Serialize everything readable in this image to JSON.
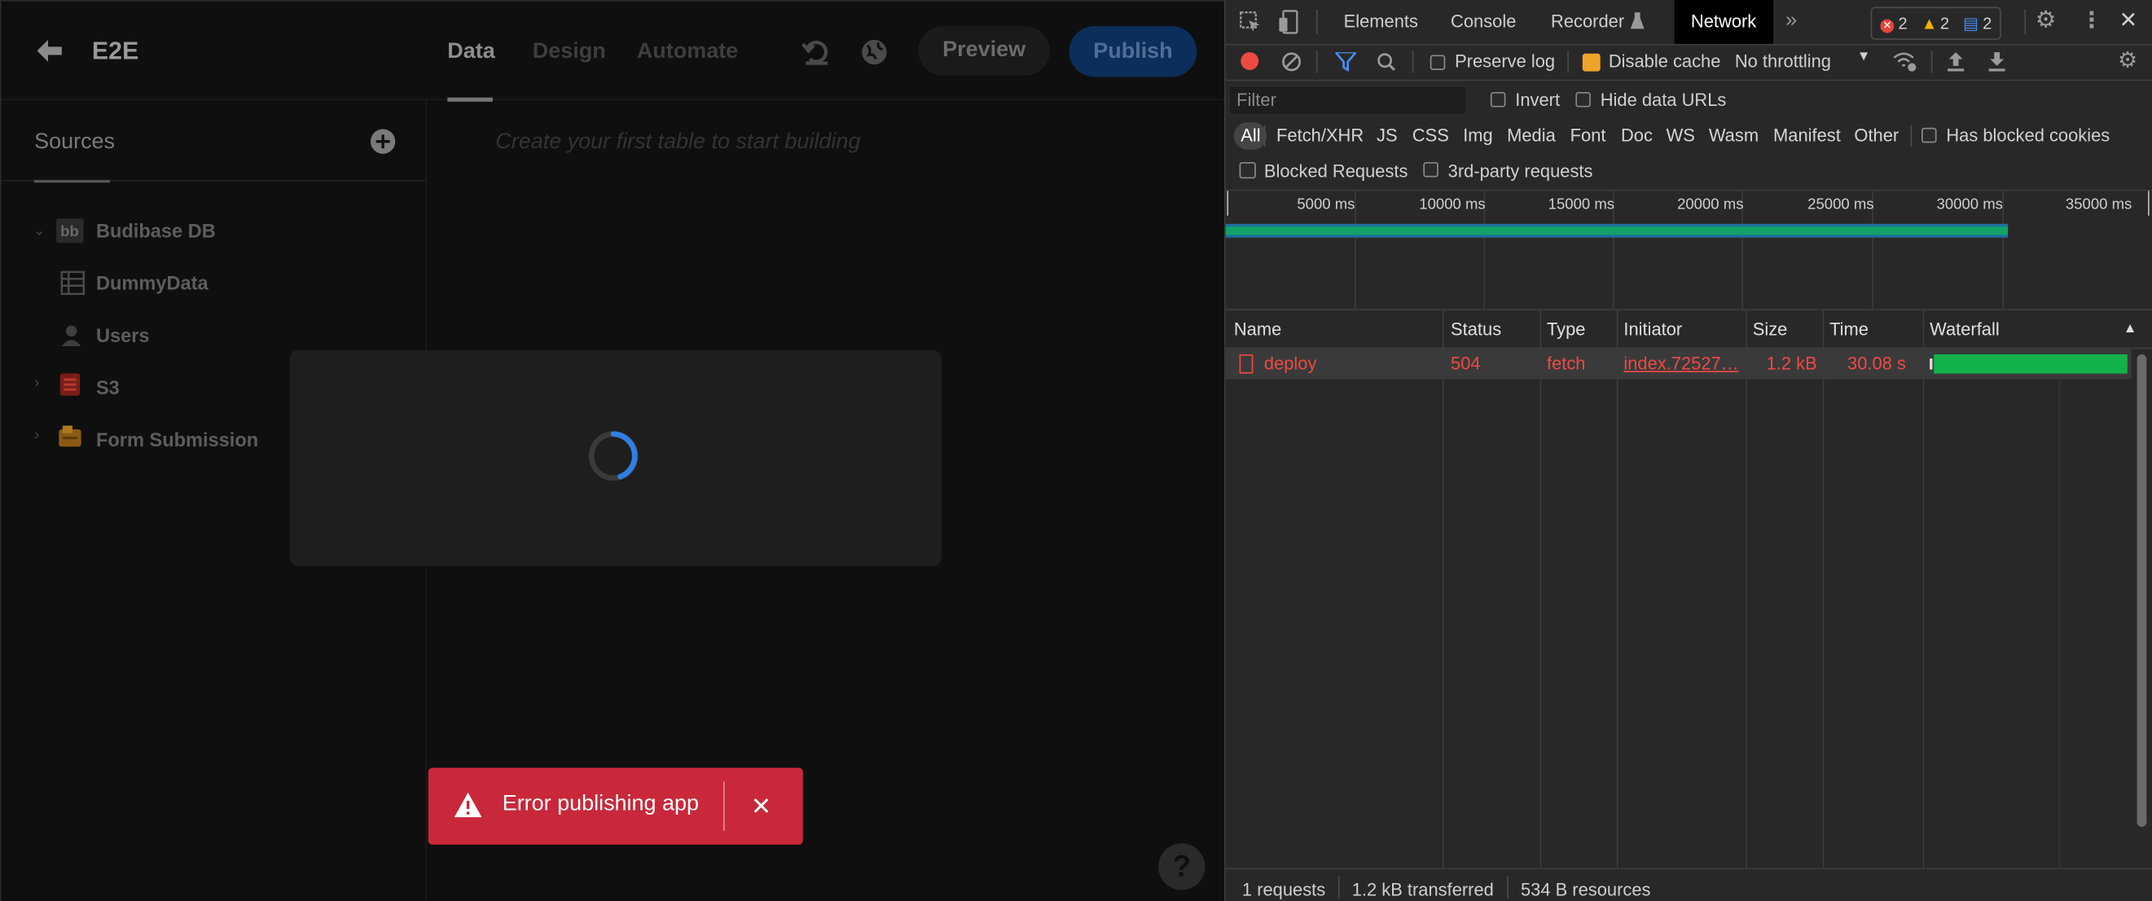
{
  "app": {
    "name": "E2E",
    "nav_tabs": [
      "Data",
      "Design",
      "Automate"
    ],
    "preview_label": "Preview",
    "publish_label": "Publish",
    "sidebar_title": "Sources",
    "sources": [
      {
        "label": "Budibase DB",
        "icon": "budibase-db-icon"
      },
      {
        "label": "DummyData",
        "icon": "table-icon"
      },
      {
        "label": "Users",
        "icon": "users-icon"
      },
      {
        "label": "S3",
        "icon": "s3-icon"
      },
      {
        "label": "Form Submission",
        "icon": "form-icon"
      }
    ],
    "empty_hint": "Create your first table to start building",
    "toast_text": "Error publishing app",
    "help_label": "?"
  },
  "devtools": {
    "tabs": [
      "Elements",
      "Console",
      "Recorder",
      "Network"
    ],
    "active_tab": "Network",
    "badges": {
      "errors": "2",
      "warnings": "2",
      "messages": "2"
    },
    "preserve_log": "Preserve log",
    "disable_cache": "Disable cache",
    "throttling": "No throttling",
    "filter_placeholder": "Filter",
    "invert": "Invert",
    "hide_data_urls": "Hide data URLs",
    "types": [
      "All",
      "Fetch/XHR",
      "JS",
      "CSS",
      "Img",
      "Media",
      "Font",
      "Doc",
      "WS",
      "Wasm",
      "Manifest",
      "Other"
    ],
    "has_blocked_cookies": "Has blocked cookies",
    "blocked_requests": "Blocked Requests",
    "third_party": "3rd-party requests",
    "timeline_ticks": [
      "5000 ms",
      "10000 ms",
      "15000 ms",
      "20000 ms",
      "25000 ms",
      "30000 ms",
      "35000 ms"
    ],
    "columns": [
      "Name",
      "Status",
      "Type",
      "Initiator",
      "Size",
      "Time",
      "Waterfall"
    ],
    "requests": [
      {
        "name": "deploy",
        "status": "504",
        "type": "fetch",
        "initiator": "index.72527…",
        "size": "1.2 kB",
        "time": "30.08 s"
      }
    ],
    "status_bar": [
      "1 requests",
      "1.2 kB transferred",
      "534 B resources"
    ]
  },
  "colors": {
    "error": "#ee4a42",
    "accent_publish": "#0c2e5a",
    "toast": "#c8283a",
    "waterfall": "#12b24a"
  }
}
